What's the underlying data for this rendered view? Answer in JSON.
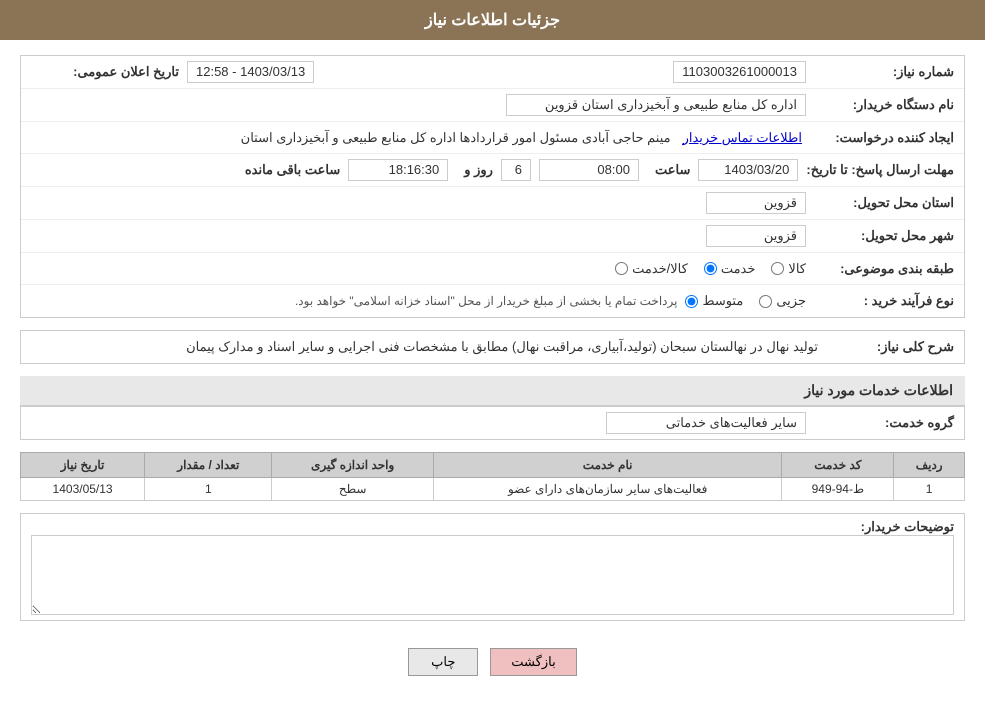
{
  "header": {
    "title": "جزئیات اطلاعات نیاز"
  },
  "fields": {
    "need_number_label": "شماره نیاز:",
    "need_number_value": "1103003261000013",
    "buyer_org_label": "نام دستگاه خریدار:",
    "buyer_org_value": "اداره کل منابع طبیعی و آبخیزداری استان قزوین",
    "creator_label": "ایجاد کننده درخواست:",
    "creator_value": "مینم حاجی آبادی مسئول امور قراردادها اداره کل منابع طبیعی و آبخیزداری استان",
    "creator_link": "اطلاعات تماس خریدار",
    "date_label": "تاریخ اعلان عمومی:",
    "date_value": "1403/03/13 - 12:58",
    "send_deadline_label": "مهلت ارسال پاسخ: تا تاریخ:",
    "send_date": "1403/03/20",
    "send_time": "08:00",
    "send_days": "6",
    "send_remaining": "18:16:30",
    "send_time_label": "ساعت",
    "send_day_label": "روز و",
    "send_remaining_label": "ساعت باقی مانده",
    "province_label": "استان محل تحویل:",
    "province_value": "قزوین",
    "city_label": "شهر محل تحویل:",
    "city_value": "قزوین",
    "category_label": "طبقه بندی موضوعی:",
    "category_kala": "کالا",
    "category_khadamat": "خدمت",
    "category_kala_khadamat": "کالا/خدمت",
    "purchase_type_label": "نوع فرآیند خرید :",
    "purchase_jozi": "جزیی",
    "purchase_motavaset": "متوسط",
    "purchase_note": "پرداخت تمام یا بخشی از مبلغ خریدار از محل \"اسناد خزانه اسلامی\" خواهد بود.",
    "need_desc_label": "شرح کلی نیاز:",
    "need_desc_value": "تولید نهال در نهالستان سبحان (تولید،آبیاری، مراقبت نهال) مطابق با مشخصات فنی اجرایی و سایر اسناد و مدارک پیمان",
    "services_title": "اطلاعات خدمات مورد نیاز",
    "service_group_label": "گروه خدمت:",
    "service_group_value": "سایر فعالیت‌های خدماتی",
    "table": {
      "headers": [
        "ردیف",
        "کد خدمت",
        "نام خدمت",
        "واحد اندازه گیری",
        "تعداد / مقدار",
        "تاریخ نیاز"
      ],
      "rows": [
        {
          "row": "1",
          "code": "ط-94-949",
          "name": "فعالیت‌های سایر سازمان‌های دارای عضو",
          "unit": "سطح",
          "qty": "1",
          "date": "1403/05/13"
        }
      ]
    },
    "buyer_notes_label": "توضیحات خریدار:",
    "buyer_notes_value": ""
  },
  "buttons": {
    "print": "چاپ",
    "back": "بازگشت"
  }
}
